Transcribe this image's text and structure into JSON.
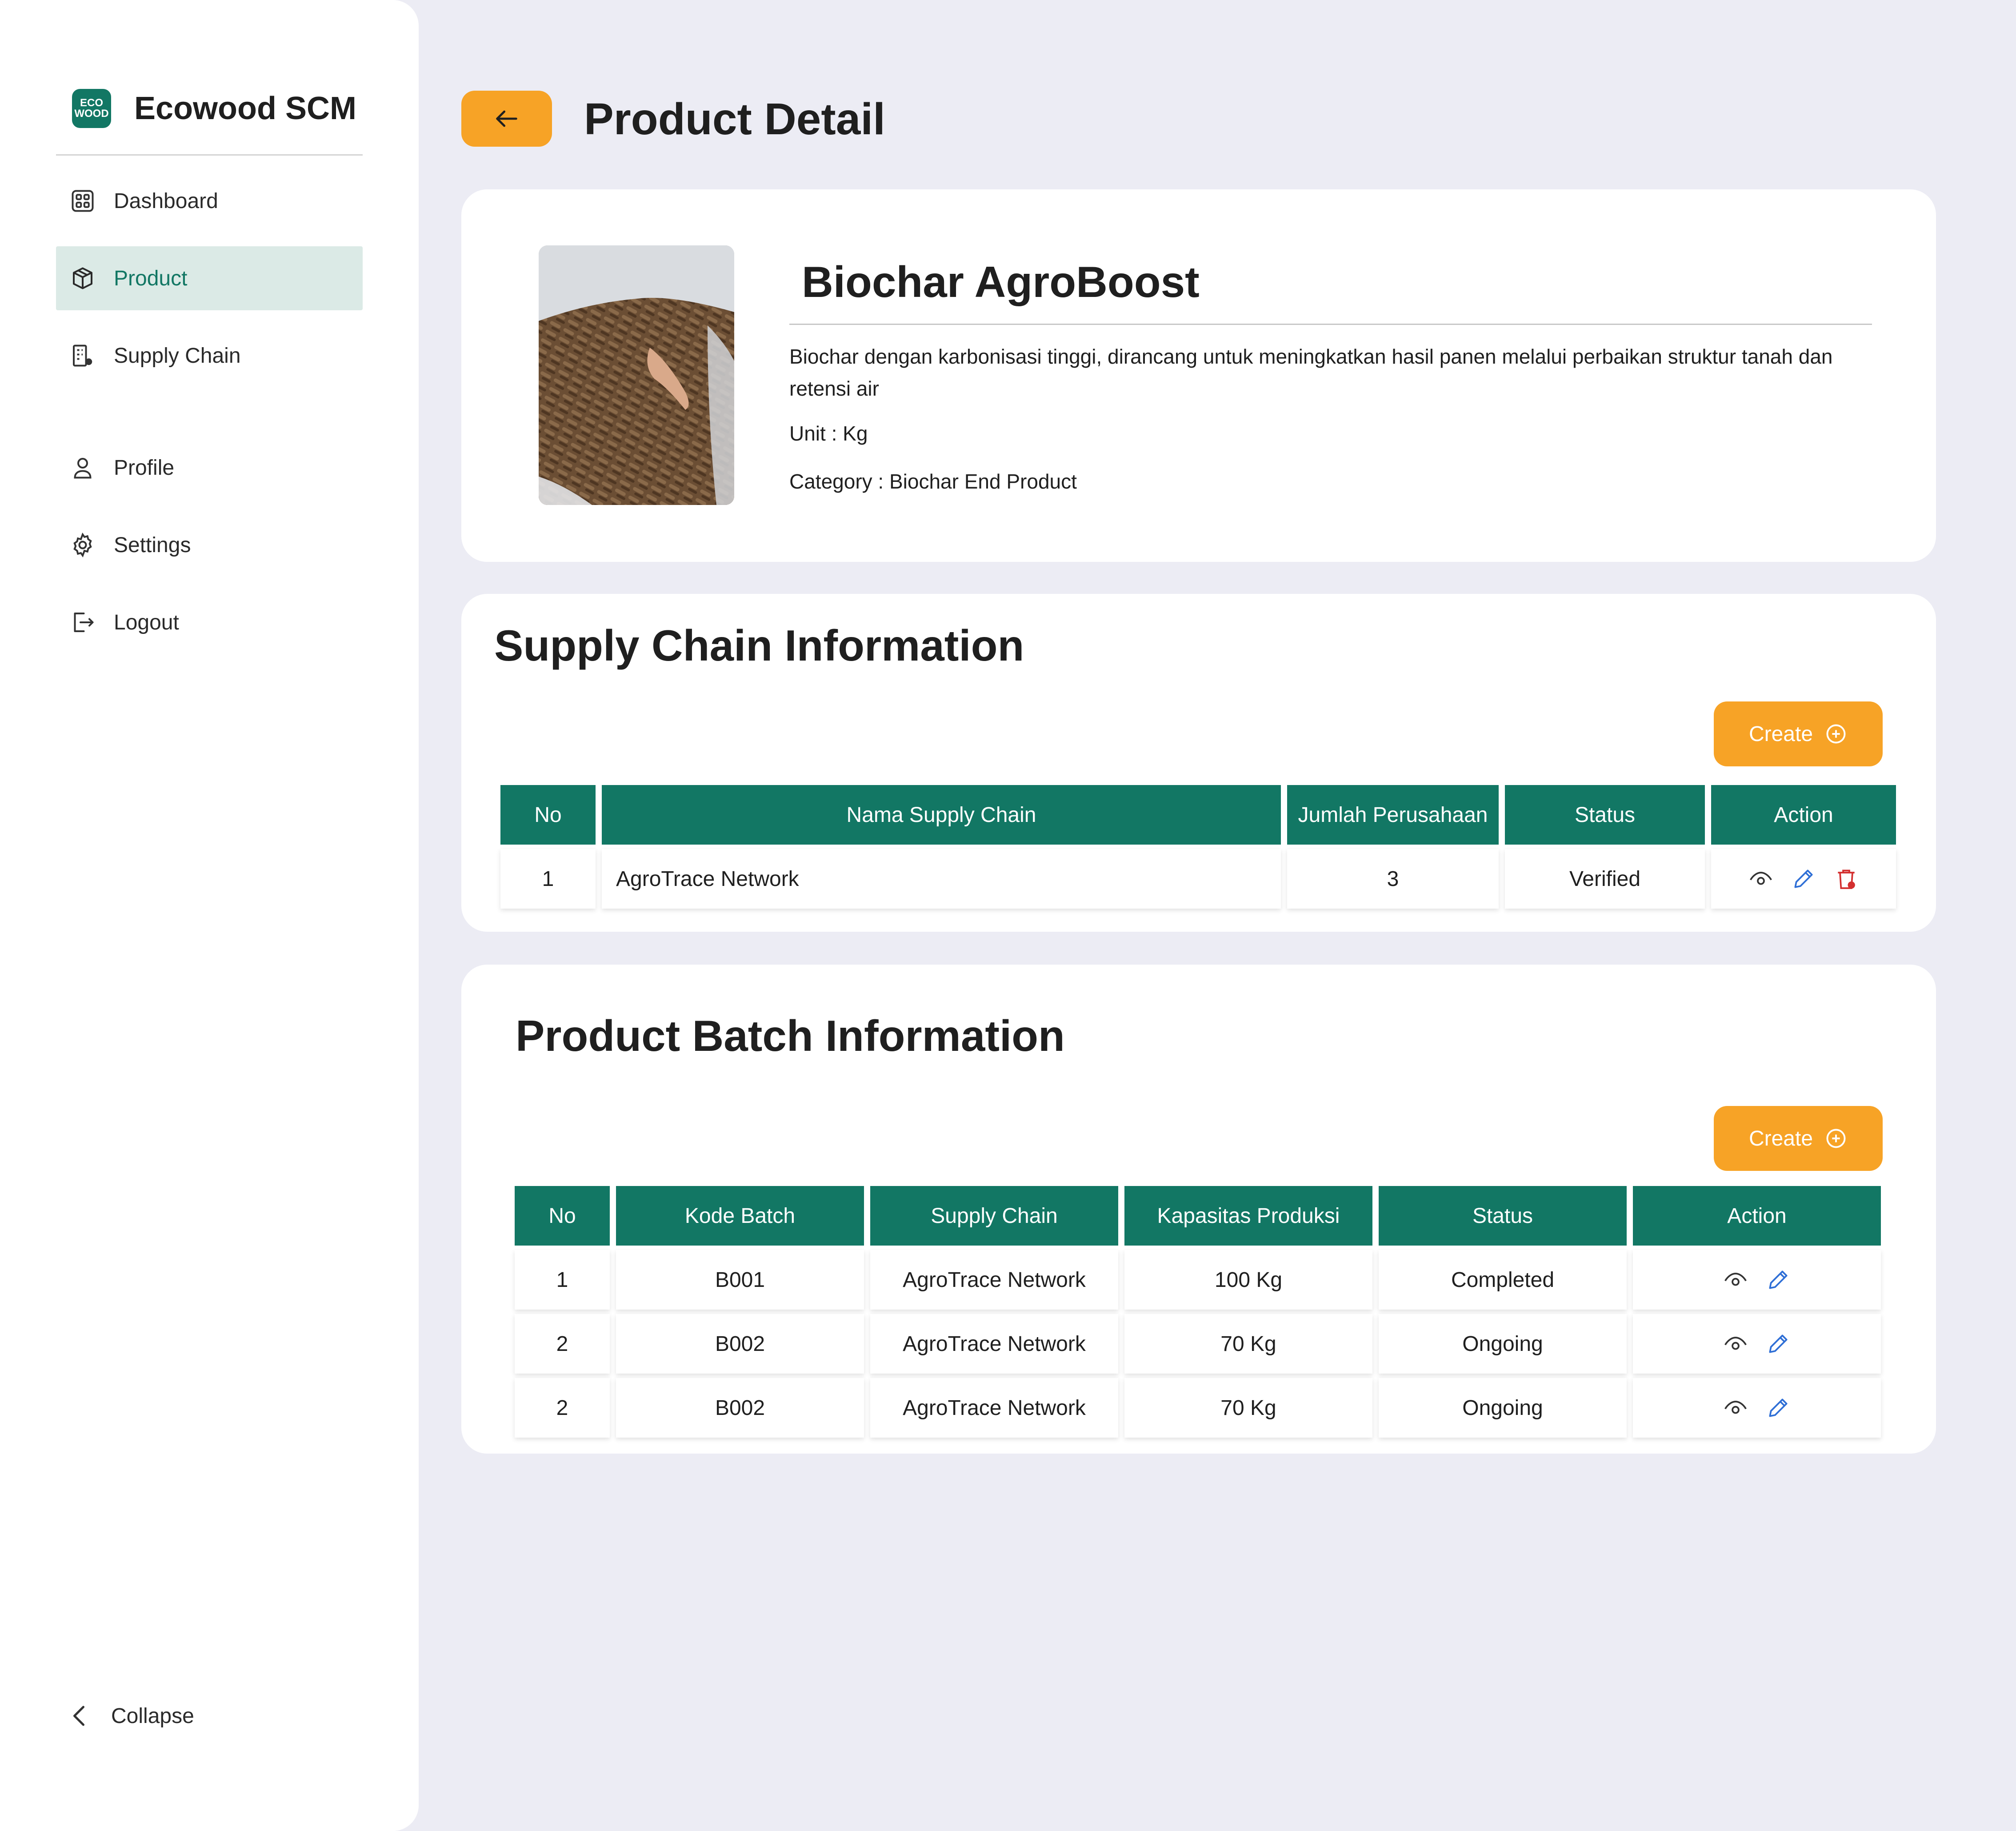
{
  "brand": {
    "logo_line1": "ECO",
    "logo_line2": "WOOD",
    "title": "Ecowood SCM"
  },
  "sidebar": {
    "items": [
      {
        "label": "Dashboard",
        "icon": "dashboard-grid-icon"
      },
      {
        "label": "Product",
        "icon": "box-icon",
        "active": true
      },
      {
        "label": "Supply Chain",
        "icon": "building-icon"
      },
      {
        "label": "Profile",
        "icon": "user-icon"
      },
      {
        "label": "Settings",
        "icon": "gear-icon"
      },
      {
        "label": "Logout",
        "icon": "logout-icon"
      }
    ],
    "collapse_label": "Collapse"
  },
  "header": {
    "title": "Product Detail",
    "back_icon": "arrow-left-icon"
  },
  "product": {
    "name": "Biochar AgroBoost",
    "description": "Biochar dengan karbonisasi tinggi, dirancang untuk meningkatkan hasil panen melalui perbaikan struktur tanah dan retensi air",
    "unit": "Unit : Kg",
    "category": "Category : Biochar End Product"
  },
  "supply_chain": {
    "title": "Supply Chain Information",
    "create_label": "Create",
    "columns": [
      "No",
      "Nama Supply Chain",
      "Jumlah Perusahaan",
      "Status",
      "Action"
    ],
    "rows": [
      {
        "no": "1",
        "name": "AgroTrace Network",
        "count": "3",
        "status": "Verified"
      }
    ]
  },
  "batches": {
    "title": "Product Batch Information",
    "create_label": "Create",
    "columns": [
      "No",
      "Kode Batch",
      "Supply Chain",
      "Kapasitas Produksi",
      "Status",
      "Action"
    ],
    "rows": [
      {
        "no": "1",
        "code": "B001",
        "chain": "AgroTrace Network",
        "capacity": "100 Kg",
        "status": "Completed"
      },
      {
        "no": "2",
        "code": "B002",
        "chain": "AgroTrace Network",
        "capacity": "70 Kg",
        "status": "Ongoing"
      },
      {
        "no": "2",
        "code": "B002",
        "chain": "AgroTrace Network",
        "capacity": "70 Kg",
        "status": "Ongoing"
      }
    ]
  },
  "colors": {
    "primary": "#127764",
    "accent": "#F7A326",
    "active_bg": "#DBEAE6",
    "page_bg": "#ECECF4",
    "edit": "#2F6FD6",
    "delete": "#D32F2F"
  }
}
